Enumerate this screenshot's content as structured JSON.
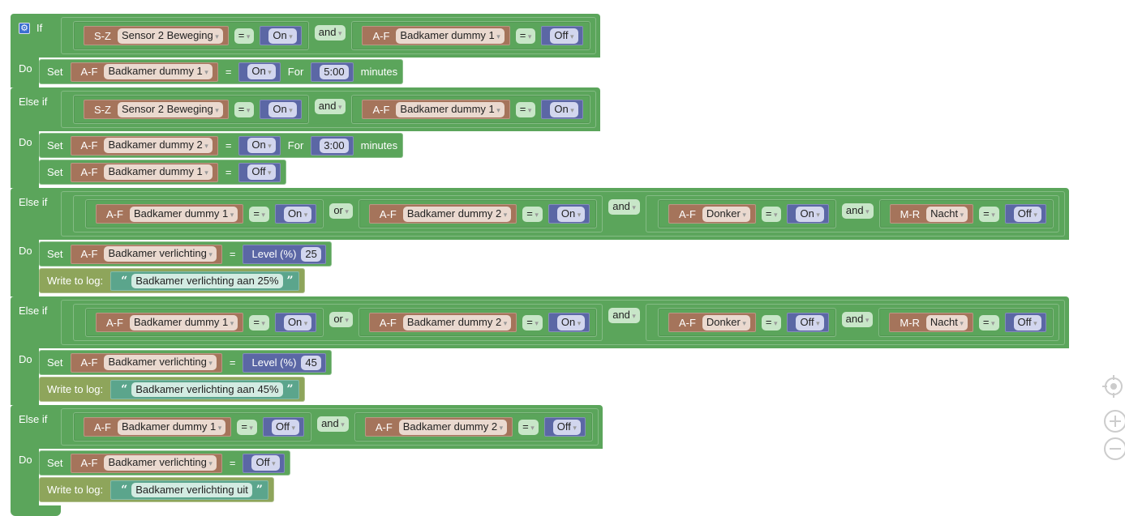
{
  "colors": {
    "logic": "#5ba55b",
    "device": "#a5745b",
    "value": "#5b67a5",
    "log": "#8ea55b",
    "text": "#5ba58c"
  },
  "branches": [
    {
      "keyword": "If",
      "do_label": "Do",
      "condition": {
        "type": "logic",
        "op": "and",
        "left": {
          "type": "compare",
          "prefix": "S-Z",
          "device": "Sensor 2 Beweging",
          "op": "=",
          "value": "On"
        },
        "right": {
          "type": "compare",
          "prefix": "A-F",
          "device": "Badkamer dummy 1",
          "op": "=",
          "value": "Off"
        }
      },
      "actions": [
        {
          "type": "set",
          "label": "Set",
          "prefix": "A-F",
          "device": "Badkamer dummy 1",
          "op": "=",
          "value": "On",
          "for_label": "For",
          "duration": "5:00",
          "unit": "minutes"
        }
      ]
    },
    {
      "keyword": "Else if",
      "do_label": "Do",
      "condition": {
        "type": "logic",
        "op": "and",
        "left": {
          "type": "compare",
          "prefix": "S-Z",
          "device": "Sensor 2 Beweging",
          "op": "=",
          "value": "On"
        },
        "right": {
          "type": "compare",
          "prefix": "A-F",
          "device": "Badkamer dummy 1",
          "op": "=",
          "value": "On"
        }
      },
      "actions": [
        {
          "type": "set",
          "label": "Set",
          "prefix": "A-F",
          "device": "Badkamer dummy 2",
          "op": "=",
          "value": "On",
          "for_label": "For",
          "duration": "3:00",
          "unit": "minutes"
        },
        {
          "type": "set",
          "label": "Set",
          "prefix": "A-F",
          "device": "Badkamer dummy 1",
          "op": "=",
          "value": "Off"
        }
      ]
    },
    {
      "keyword": "Else if",
      "do_label": "Do",
      "condition": {
        "type": "logic",
        "op": "and",
        "left": {
          "type": "logic",
          "op": "or",
          "left": {
            "type": "compare",
            "prefix": "A-F",
            "device": "Badkamer dummy 1",
            "op": "=",
            "value": "On"
          },
          "right": {
            "type": "compare",
            "prefix": "A-F",
            "device": "Badkamer dummy 2",
            "op": "=",
            "value": "On"
          }
        },
        "right": {
          "type": "logic",
          "op": "and",
          "left": {
            "type": "compare",
            "prefix": "A-F",
            "device": "Donker",
            "op": "=",
            "value": "On"
          },
          "right": {
            "type": "compare",
            "prefix": "M-R",
            "device": "Nacht",
            "op": "=",
            "value": "Off"
          }
        }
      },
      "actions": [
        {
          "type": "set",
          "label": "Set",
          "prefix": "A-F",
          "device": "Badkamer verlichting",
          "op": "=",
          "level_label": "Level (%)",
          "level": "25"
        },
        {
          "type": "log",
          "label": "Write to log:",
          "open_quote": "“",
          "text": "Badkamer verlichting aan 25%",
          "close_quote": "”"
        }
      ]
    },
    {
      "keyword": "Else if",
      "do_label": "Do",
      "condition": {
        "type": "logic",
        "op": "and",
        "left": {
          "type": "logic",
          "op": "or",
          "left": {
            "type": "compare",
            "prefix": "A-F",
            "device": "Badkamer dummy 1",
            "op": "=",
            "value": "On"
          },
          "right": {
            "type": "compare",
            "prefix": "A-F",
            "device": "Badkamer dummy 2",
            "op": "=",
            "value": "On"
          }
        },
        "right": {
          "type": "logic",
          "op": "and",
          "left": {
            "type": "compare",
            "prefix": "A-F",
            "device": "Donker",
            "op": "=",
            "value": "Off"
          },
          "right": {
            "type": "compare",
            "prefix": "M-R",
            "device": "Nacht",
            "op": "=",
            "value": "Off"
          }
        }
      },
      "actions": [
        {
          "type": "set",
          "label": "Set",
          "prefix": "A-F",
          "device": "Badkamer verlichting",
          "op": "=",
          "level_label": "Level (%)",
          "level": "45"
        },
        {
          "type": "log",
          "label": "Write to log:",
          "open_quote": "“",
          "text": "Badkamer verlichting aan 45%",
          "close_quote": "”"
        }
      ]
    },
    {
      "keyword": "Else if",
      "do_label": "Do",
      "condition": {
        "type": "logic",
        "op": "and",
        "left": {
          "type": "compare",
          "prefix": "A-F",
          "device": "Badkamer dummy 1",
          "op": "=",
          "value": "Off"
        },
        "right": {
          "type": "compare",
          "prefix": "A-F",
          "device": "Badkamer dummy 2",
          "op": "=",
          "value": "Off"
        }
      },
      "actions": [
        {
          "type": "set",
          "label": "Set",
          "prefix": "A-F",
          "device": "Badkamer verlichting",
          "op": "=",
          "value": "Off"
        },
        {
          "type": "log",
          "label": "Write to log:",
          "open_quote": "“",
          "text": "Badkamer verlichting uit",
          "close_quote": "”"
        }
      ]
    }
  ],
  "controls": {
    "icons": [
      "recenter-icon",
      "zoom-in-icon",
      "zoom-out-icon"
    ]
  }
}
